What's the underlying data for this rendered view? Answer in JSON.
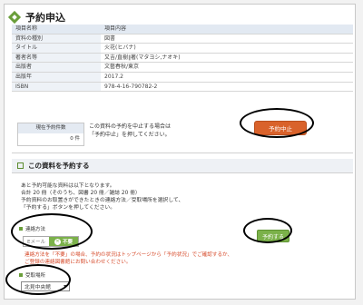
{
  "page": {
    "title": "予約申込"
  },
  "book_info": {
    "header": {
      "label": "項目名称",
      "value": "項目内容"
    },
    "rows": [
      {
        "label": "資料の種別",
        "value": "図書"
      },
      {
        "label": "タイトル",
        "value": "火花(ヒバナ)"
      },
      {
        "label": "著者名等",
        "value": "又吉/直樹∥著(マタヨシ,ナオキ)"
      },
      {
        "label": "出版者",
        "value": "文藝春秋/東京"
      },
      {
        "label": "出版年",
        "value": "2017.2"
      },
      {
        "label": "ISBN",
        "value": "978-4-16-790782-2"
      }
    ]
  },
  "current_reservations": {
    "label": "現在予約件数",
    "value": "0 件"
  },
  "cancel": {
    "text_line1": "この資料の予約を中止する場合は",
    "text_line2": "「予約中止」を押してください。",
    "button_label": "予約中止"
  },
  "reserve_section": {
    "title": "この資料を予約する",
    "notes": [
      "あと予約可能な資料は以下となります。",
      "合計 20 冊（そのうち、図書 20 冊／雑誌 20 冊）",
      "予約資料のお取置きができたときの連絡方法／受取場所を選択して、",
      "「予約する」ボタンを押してください。"
    ],
    "contact_label": "連絡方法",
    "contact_options": {
      "email": "Eメール",
      "none": "不要"
    },
    "reserve_button_label": "予約する",
    "warning_line1": "連絡方法を「不要」の場合、予約の状況はトップページから「予約状況」でご確認するか、",
    "warning_line2": "ご登録の連絡図書館にお問い合わせください。",
    "pickup_label": "受取場所",
    "pickup_selected": "北見中央館"
  },
  "colors": {
    "accent_green": "#7bb14a",
    "cancel_orange": "#d9622b",
    "warning_red": "#d64a2a"
  }
}
